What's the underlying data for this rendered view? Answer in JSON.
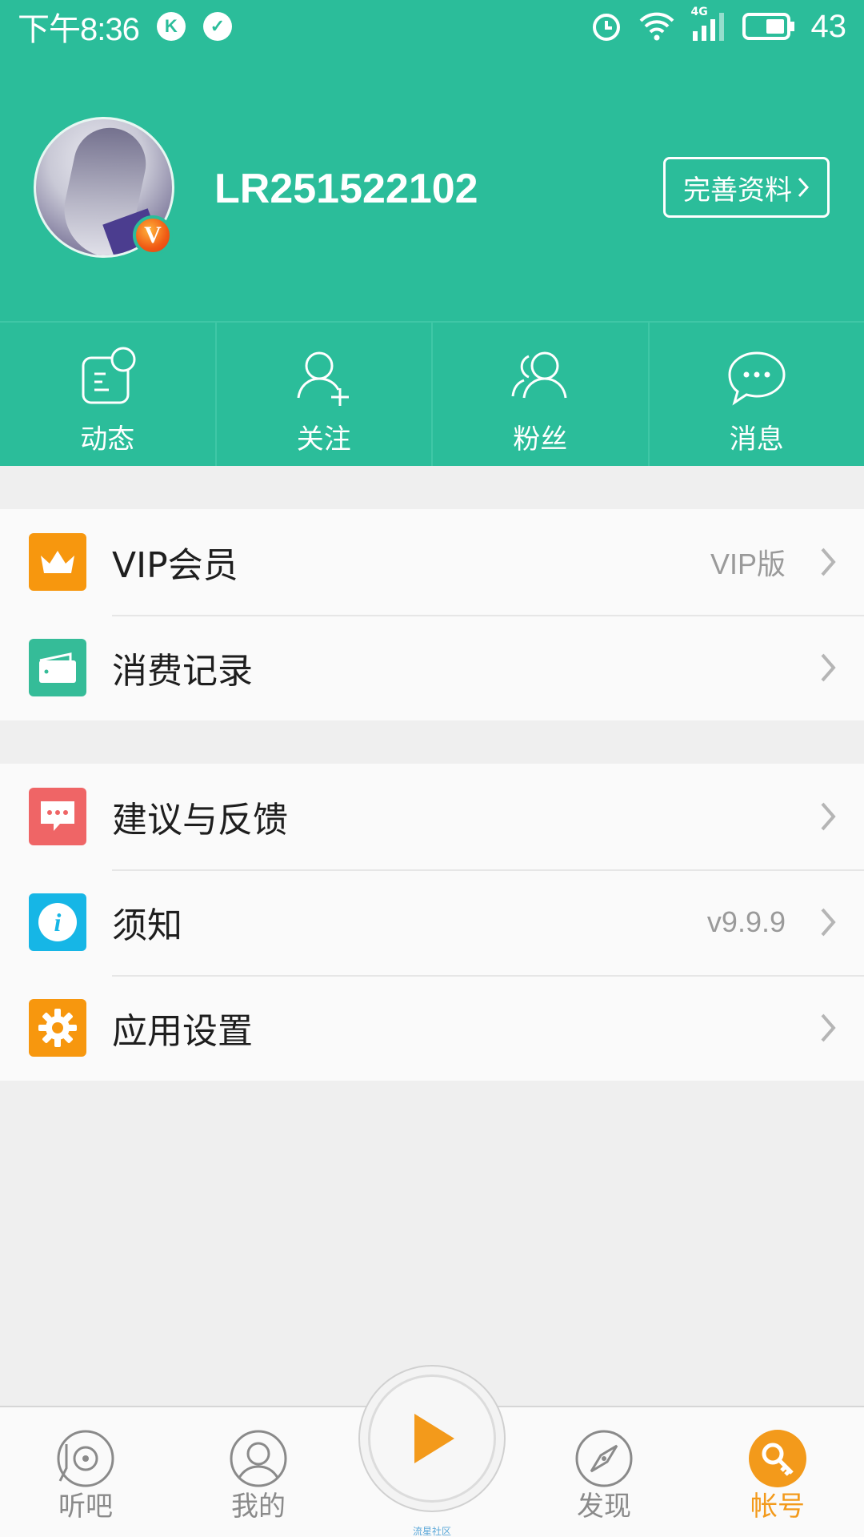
{
  "status_bar": {
    "time": "下午8:36",
    "network": "4G",
    "battery": "43"
  },
  "profile": {
    "username": "LR251522102",
    "vip_badge": "V",
    "edit_label": "完善资料"
  },
  "actions": [
    {
      "label": "动态"
    },
    {
      "label": "关注"
    },
    {
      "label": "粉丝"
    },
    {
      "label": "消息"
    }
  ],
  "menu_group1": [
    {
      "label": "VIP会员",
      "value": "VIP版",
      "icon": "crown-icon",
      "color": "#f7970e"
    },
    {
      "label": "消费记录",
      "value": "",
      "icon": "wallet-icon",
      "color": "#35bc98"
    }
  ],
  "menu_group2": [
    {
      "label": "建议与反馈",
      "value": "",
      "icon": "feedback-icon",
      "color": "#ef6566"
    },
    {
      "label": "须知",
      "value": "v9.9.9",
      "icon": "info-icon",
      "color": "#16b6e6"
    },
    {
      "label": "应用设置",
      "value": "",
      "icon": "gear-icon",
      "color": "#f7970e"
    }
  ],
  "bottom_nav": {
    "items": [
      {
        "label": "听吧"
      },
      {
        "label": "我的"
      },
      {
        "label": "发现"
      },
      {
        "label": "帐号"
      }
    ],
    "play_caption": "流星社区",
    "active_color": "#f39a1b"
  },
  "colors": {
    "brand": "#2bbd9a"
  }
}
